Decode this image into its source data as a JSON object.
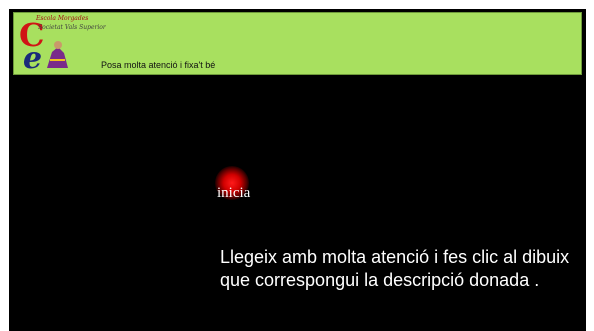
{
  "header": {
    "logo_line1": "Escola Morgades",
    "logo_line2": "Societat Vals Superior",
    "subtitle": "Posa molta atenció i fixa't bé",
    "background": "#a8e05f"
  },
  "main": {
    "start_label": "inicia",
    "instructions": "Llegeix amb molta atenció i fes clic al dibuix que correspongui la descripció donada .",
    "background": "#000000",
    "glow_color": "#ff1a1a"
  }
}
